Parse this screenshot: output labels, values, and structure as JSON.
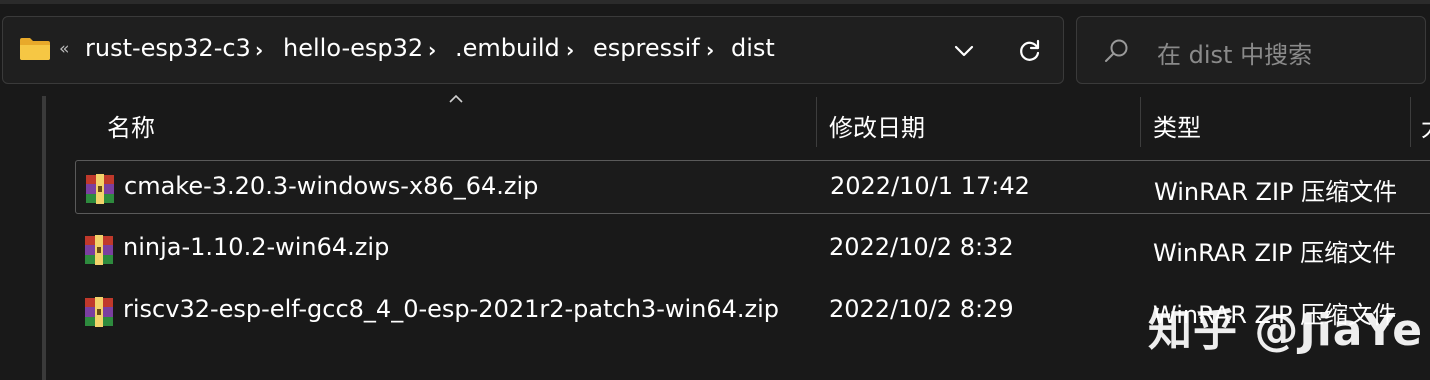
{
  "breadcrumb": {
    "overflow": "«",
    "items": [
      "rust-esp32-c3",
      "hello-esp32",
      ".embuild",
      "espressif",
      "dist"
    ],
    "separator": "›"
  },
  "search": {
    "placeholder": "在 dist 中搜索"
  },
  "columns": {
    "name": "名称",
    "date": "修改日期",
    "type": "类型",
    "size": "大"
  },
  "files": [
    {
      "name": "cmake-3.20.3-windows-x86_64.zip",
      "date": "2022/10/1 17:42",
      "type": "WinRAR ZIP 压缩文件",
      "selected": true
    },
    {
      "name": "ninja-1.10.2-win64.zip",
      "date": "2022/10/2 8:32",
      "type": "WinRAR ZIP 压缩文件",
      "selected": false
    },
    {
      "name": "riscv32-esp-elf-gcc8_4_0-esp-2021r2-patch3-win64.zip",
      "date": "2022/10/2 8:29",
      "type": "WinRAR ZIP 压缩文件",
      "selected": false
    }
  ],
  "watermark": "知乎 @JiaYe",
  "colors": {
    "background": "#191919",
    "folder": "#f6c744",
    "text": "#ffffff",
    "muted": "#8a8a8a"
  }
}
